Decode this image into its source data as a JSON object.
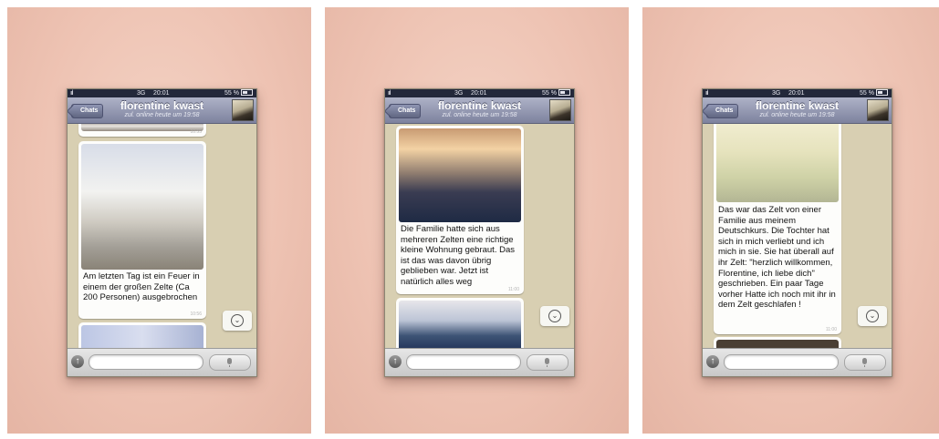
{
  "status_bar": {
    "carrier_signal": "ııl",
    "network": "3G",
    "time": "20:01",
    "battery_percent": "55 %"
  },
  "header": {
    "back_label": "Chats",
    "contact_name": "florentine kwast",
    "contact_status": "zul. online heute um 19:58"
  },
  "screens": [
    {
      "messages": [
        {
          "kind": "image",
          "timestamp": "10:55"
        },
        {
          "kind": "image-caption",
          "text": "Am letzten Tag ist ein Feuer in einem der großen Zelte (Ca 200 Personen) ausgebrochen",
          "timestamp": "10:56"
        },
        {
          "kind": "image"
        }
      ]
    },
    {
      "messages": [
        {
          "kind": "image-caption",
          "text": "Die Familie hatte sich aus mehreren Zelten eine richtige kleine Wohnung gebraut. Das ist das was davon übrig geblieben war. Jetzt ist natürlich alles weg",
          "timestamp": "11:00"
        },
        {
          "kind": "image"
        }
      ]
    },
    {
      "messages": [
        {
          "kind": "image-caption",
          "text": "Das war das Zelt von einer Familie aus meinem Deutschkurs. Die Tochter hat sich in mich verliebt und ich mich in sie. Sie hat überall auf ihr Zelt: \"herzlich willkommen, Florentine, ich liebe dich\" geschrieben. Ein paar Tage vorher Hatte ich noch mit ihr in dem Zelt geschlafen !",
          "timestamp": "11:00"
        },
        {
          "kind": "image"
        }
      ]
    }
  ],
  "icons": {
    "scroll_down": "chevron-down-icon",
    "attach": "attach-icon",
    "mic": "microphone-icon"
  },
  "colors": {
    "navbar": "#8e93ae",
    "statusbar": "#23283a",
    "chat_background": "#d8cfb2",
    "bubble": "#fdfdfb",
    "backdrop": "#eec3b3"
  }
}
